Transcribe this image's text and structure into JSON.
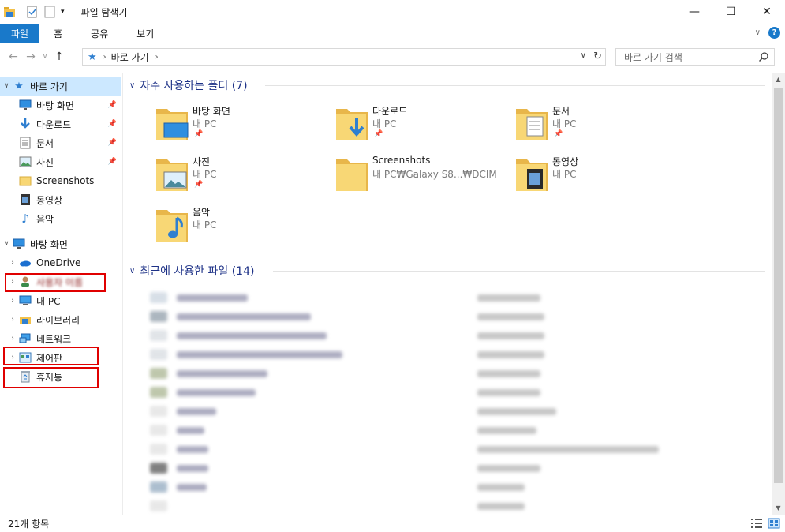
{
  "window": {
    "title": "파일 탐색기",
    "controls": {
      "minimize": "—",
      "maximize": "☐",
      "close": "✕"
    }
  },
  "ribbon": {
    "tabs": [
      "파일",
      "홈",
      "공유",
      "보기"
    ],
    "expand_icon": "chevron-down-icon",
    "help_label": "?"
  },
  "address_bar": {
    "breadcrumb": [
      "바로 가기"
    ],
    "search_placeholder": "바로 가기 검색"
  },
  "nav_pane": {
    "quick_access": {
      "label": "바로 가기",
      "items": [
        {
          "label": "바탕 화면",
          "icon": "desktop-icon",
          "pinned": true
        },
        {
          "label": "다운로드",
          "icon": "download-icon",
          "pinned": true
        },
        {
          "label": "문서",
          "icon": "document-icon",
          "pinned": true
        },
        {
          "label": "사진",
          "icon": "picture-icon",
          "pinned": true
        },
        {
          "label": "Screenshots",
          "icon": "folder-icon",
          "pinned": false
        },
        {
          "label": "동영상",
          "icon": "video-icon",
          "pinned": false
        },
        {
          "label": "음악",
          "icon": "music-icon",
          "pinned": false
        }
      ]
    },
    "desktop": {
      "label": "바탕 화면",
      "items": [
        {
          "label": "OneDrive",
          "icon": "cloud-icon"
        },
        {
          "label": "사용자 이름",
          "icon": "user-icon"
        },
        {
          "label": "내 PC",
          "icon": "computer-icon"
        },
        {
          "label": "라이브러리",
          "icon": "library-icon"
        },
        {
          "label": "네트워크",
          "icon": "network-icon"
        },
        {
          "label": "제어판",
          "icon": "control-panel-icon"
        },
        {
          "label": "휴지통",
          "icon": "recycle-bin-icon"
        }
      ]
    }
  },
  "content": {
    "frequent_header": "자주 사용하는 폴더 (7)",
    "frequent_folders": [
      {
        "name": "바탕 화면",
        "location": "내 PC",
        "pinned": true,
        "overlay": "desktop"
      },
      {
        "name": "다운로드",
        "location": "내 PC",
        "pinned": true,
        "overlay": "download"
      },
      {
        "name": "문서",
        "location": "내 PC",
        "pinned": true,
        "overlay": "document"
      },
      {
        "name": "사진",
        "location": "내 PC",
        "pinned": true,
        "overlay": "picture"
      },
      {
        "name": "Screenshots",
        "location": "내 PC₩Galaxy S8...₩DCIM",
        "pinned": false,
        "overlay": "none"
      },
      {
        "name": "동영상",
        "location": "내 PC",
        "pinned": false,
        "overlay": "video"
      },
      {
        "name": "음악",
        "location": "내 PC",
        "pinned": false,
        "overlay": "music"
      }
    ],
    "recent_header": "최근에 사용한 파일 (14)",
    "recent_count": 12
  },
  "status": {
    "item_count": "21개 항목"
  },
  "colors": {
    "accent": "#1979ca",
    "selection": "#cce8ff",
    "group_header": "#1e3287",
    "folder": "#f8d775",
    "highlight_box": "#e00000"
  }
}
